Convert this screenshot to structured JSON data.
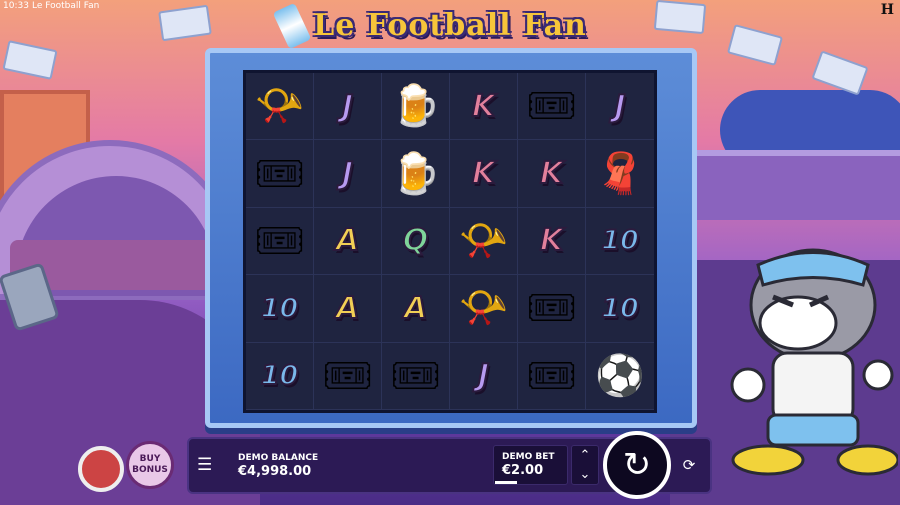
{
  "status_bar": {
    "time": "10:33",
    "app_title": "Le Football Fan",
    "brand_mark": "H"
  },
  "game": {
    "logo_text": "Le Football Fan"
  },
  "reels": [
    [
      "horn",
      "J",
      "beer",
      "K",
      "tickets",
      "J"
    ],
    [
      "tickets",
      "J",
      "beer",
      "K",
      "K",
      "scarf"
    ],
    [
      "tickets",
      "A",
      "Q",
      "horn",
      "K",
      "10"
    ],
    [
      "10",
      "A",
      "A",
      "horn",
      "tickets",
      "10"
    ],
    [
      "10",
      "tickets",
      "tickets",
      "J",
      "tickets",
      "ball"
    ]
  ],
  "icons": {
    "horn": "📯",
    "beer": "🍺",
    "tickets": "🎟",
    "scarf": "🧣",
    "ball": "⚽"
  },
  "controls": {
    "buy_bonus_label": "BUY\nBONUS",
    "menu_icon": "☰",
    "balance_label": "DEMO BALANCE",
    "balance_value": "€4,998.00",
    "bet_label": "DEMO BET",
    "bet_value": "€2.00",
    "bet_adjust": "⌃\n⌄",
    "spin_icon": "↻",
    "autoplay_icon": "⟳"
  }
}
